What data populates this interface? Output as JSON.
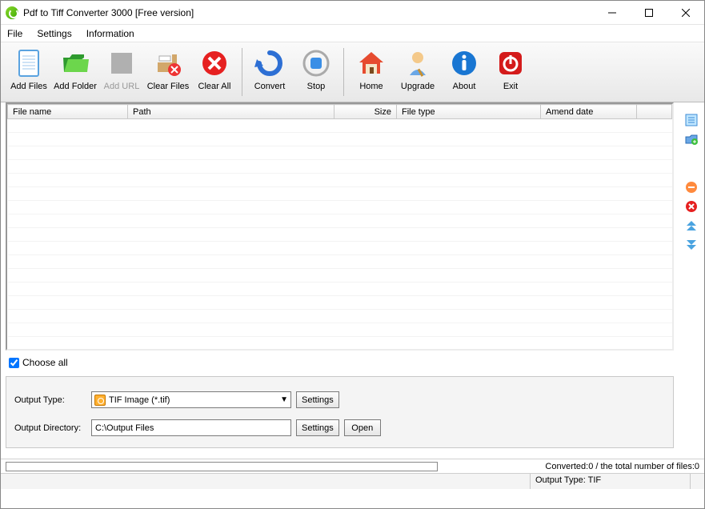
{
  "title": "Pdf to Tiff Converter 3000 [Free version]",
  "menu": {
    "file": "File",
    "settings": "Settings",
    "information": "Information"
  },
  "toolbar": {
    "add_files": "Add Files",
    "add_folder": "Add Folder",
    "add_url": "Add URL",
    "clear_files": "Clear Files",
    "clear_all": "Clear All",
    "convert": "Convert",
    "stop": "Stop",
    "home": "Home",
    "upgrade": "Upgrade",
    "about": "About",
    "exit": "Exit"
  },
  "columns": {
    "filename": "File name",
    "path": "Path",
    "size": "Size",
    "filetype": "File type",
    "amend": "Amend date"
  },
  "rows": [],
  "choose_all": "Choose all",
  "output": {
    "type_label": "Output Type:",
    "type_value": "TIF Image (*.tif)",
    "settings": "Settings",
    "dir_label": "Output Directory:",
    "dir_value": "C:\\Output Files",
    "open": "Open"
  },
  "status": {
    "converted": "Converted:0  /  the total number of files:0"
  },
  "statusbar": {
    "output_type": "Output Type: TIF"
  }
}
